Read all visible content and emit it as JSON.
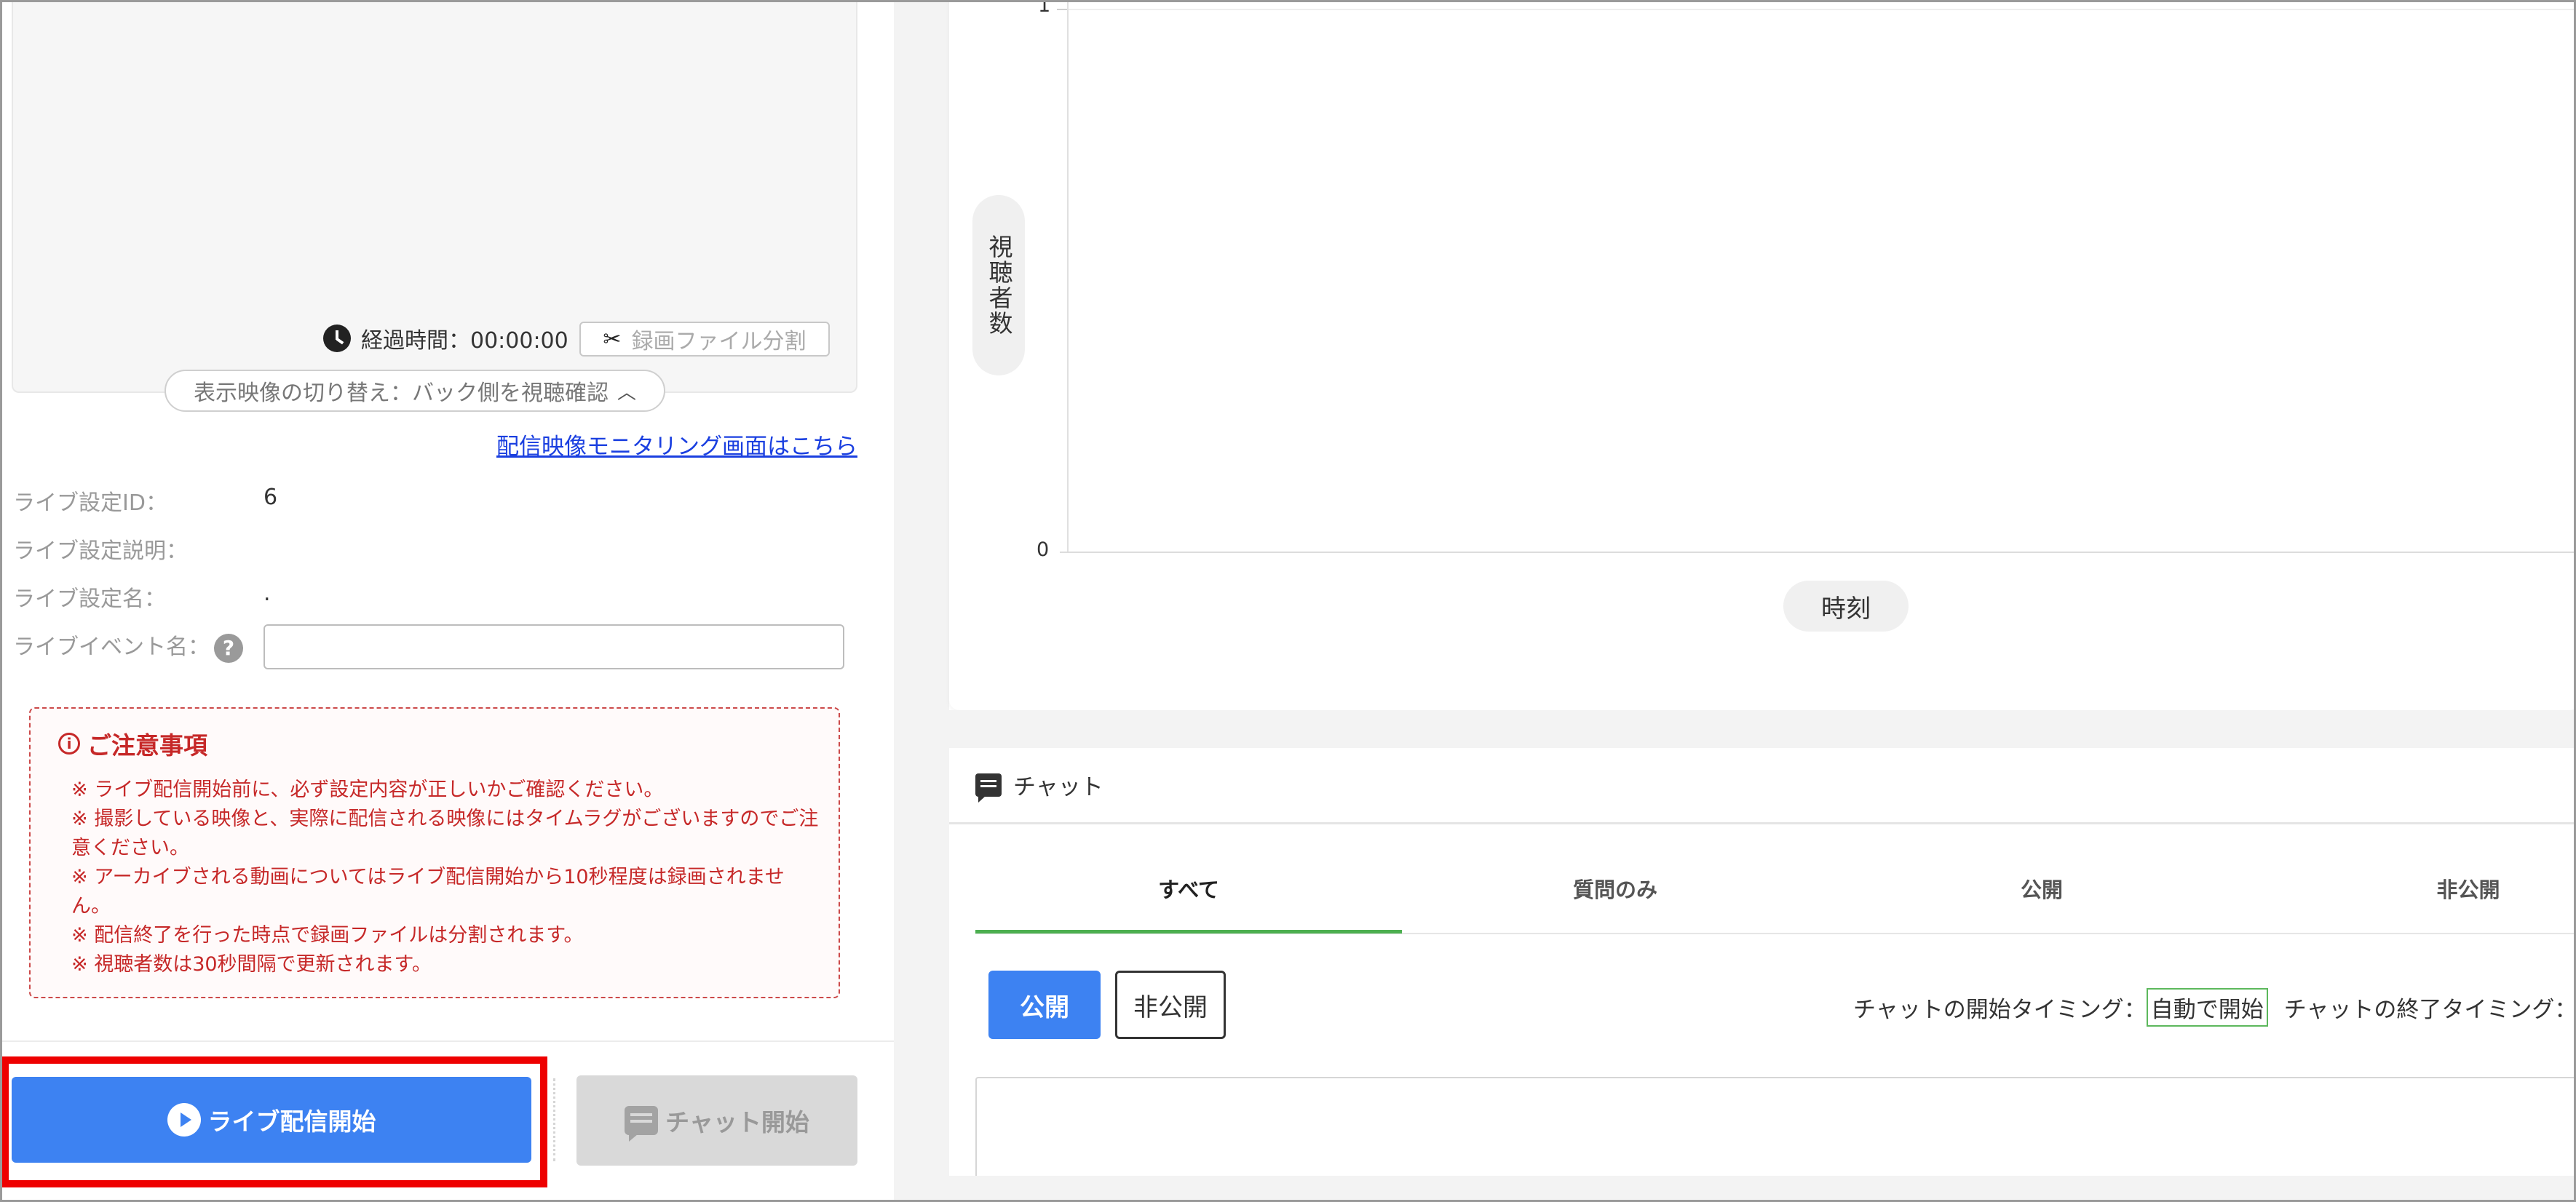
{
  "video": {
    "elapsed_label": "経過時間：00:00:00",
    "split_button_label": "録画ファイル分割",
    "toggle_label": "表示映像の切り替え：バック側を視聴確認",
    "monitor_link": "配信映像モニタリング画面はこちら"
  },
  "settings": {
    "id_label": "ライブ設定ID：",
    "id_value": "6",
    "desc_label": "ライブ設定説明：",
    "desc_value": "",
    "name_label": "ライブ設定名：",
    "name_value": ".",
    "event_label": "ライブイベント名：",
    "event_value": ""
  },
  "notice": {
    "title": "ご注意事項",
    "items": [
      "※  ライブ配信開始前に、必ず設定内容が正しいかご確認ください。",
      "※  撮影している映像と、実際に配信される映像にはタイムラグがございますのでご注意ください。",
      "※  アーカイブされる動画についてはライブ配信開始から10秒程度は録画されません。",
      "※  配信終了を行った時点で録画ファイルは分割されます。",
      "※  視聴者数は30秒間隔で更新されます。"
    ]
  },
  "actions": {
    "live_start": "ライブ配信開始",
    "chat_start": "チャット開始"
  },
  "chart_data": {
    "type": "line",
    "title": "",
    "xlabel": "時刻",
    "ylabel": "視聴者数",
    "ylim": [
      0,
      1
    ],
    "y_ticks": [
      "1",
      "0"
    ],
    "series": []
  },
  "chat": {
    "header": "チャット",
    "tabs": [
      "すべて",
      "質問のみ",
      "公開",
      "非公開"
    ],
    "active_tab": "すべて",
    "public_button": "公開",
    "private_button": "非公開",
    "start_timing_label": "チャットの開始タイミング：",
    "start_timing_value": "自動で開始",
    "end_timing_label": "チャットの終了タイミング："
  },
  "colors": {
    "primary": "#3d82f2",
    "notice": "#c62828",
    "active_tab": "#4caf50",
    "highlight": "#ee0000"
  }
}
